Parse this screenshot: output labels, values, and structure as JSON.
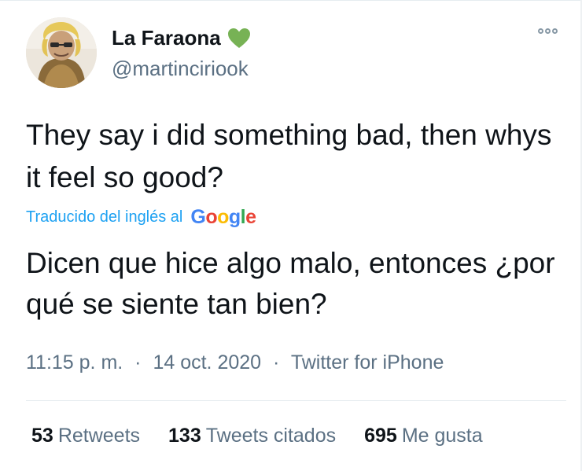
{
  "user": {
    "display_name": "La Faraona",
    "name_emoji": "green-heart-icon",
    "handle": "@martinciriook"
  },
  "tweet": {
    "text": "They say i did something bad, then whys it feel so good?",
    "translation_label": "Traducido del inglés al",
    "translation_provider": "Google",
    "translated_text": "Dicen que hice algo malo, entonces ¿por qué se siente tan bien?",
    "time": "11:15 p. m.",
    "date": "14 oct. 2020",
    "source": "Twitter for iPhone",
    "separator": "·"
  },
  "stats": {
    "retweets_count": "53",
    "retweets_label": "Retweets",
    "quotes_count": "133",
    "quotes_label": "Tweets citados",
    "likes_count": "695",
    "likes_label": "Me gusta"
  },
  "colors": {
    "link_blue": "#1da1f2",
    "heart_green": "#77b255",
    "secondary_text": "#5b7083"
  }
}
